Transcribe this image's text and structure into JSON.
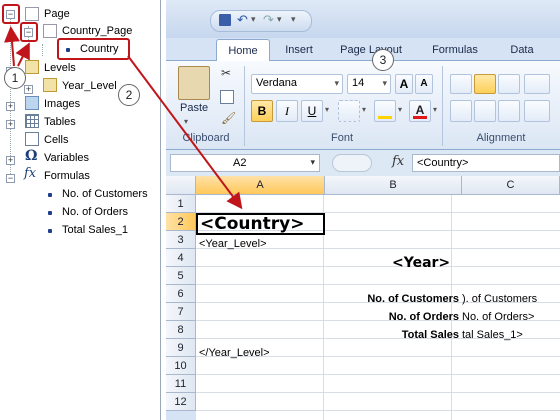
{
  "tree": {
    "page": "Page",
    "country_page": "Country_Page",
    "country": "Country",
    "levels": "Levels",
    "year_level": "Year_Level",
    "images": "Images",
    "tables": "Tables",
    "cells": "Cells",
    "variables": "Variables",
    "formulas": "Formulas",
    "formula_items": [
      "No. of Customers",
      "No. of Orders",
      "Total Sales_1"
    ]
  },
  "ribbon": {
    "tabs": [
      "Home",
      "Insert",
      "Page Layout",
      "Formulas",
      "Data"
    ],
    "paste_label": "Paste",
    "font_name": "Verdana",
    "font_size": "14",
    "groups": [
      "Clipboard",
      "Font",
      "Alignment"
    ]
  },
  "formula_bar": {
    "name_box": "A2",
    "fx": "fx",
    "content": "<Country>"
  },
  "sheet": {
    "columns": [
      "A",
      "B",
      "C"
    ],
    "rows": [
      "1",
      "2",
      "3",
      "4",
      "5",
      "6",
      "7",
      "8",
      "9",
      "10",
      "11",
      "12"
    ],
    "a2": "<Country>",
    "a3": "<Year_Level>",
    "b4": "<Year>",
    "b6": "No. of Customers",
    "c6": "). of Customers",
    "b7": "No. of Orders",
    "c7": "No. of Orders>",
    "b8": "Total Sales",
    "c8": "tal Sales_1>",
    "a9": "</Year_Level>"
  },
  "callouts": [
    "1",
    "2",
    "3"
  ],
  "colors": {
    "callout_box": "#c0161b",
    "ribbon_bg": "#d6e3f4",
    "active_tab": "#ffffff",
    "highlight": "#ffc85a"
  }
}
